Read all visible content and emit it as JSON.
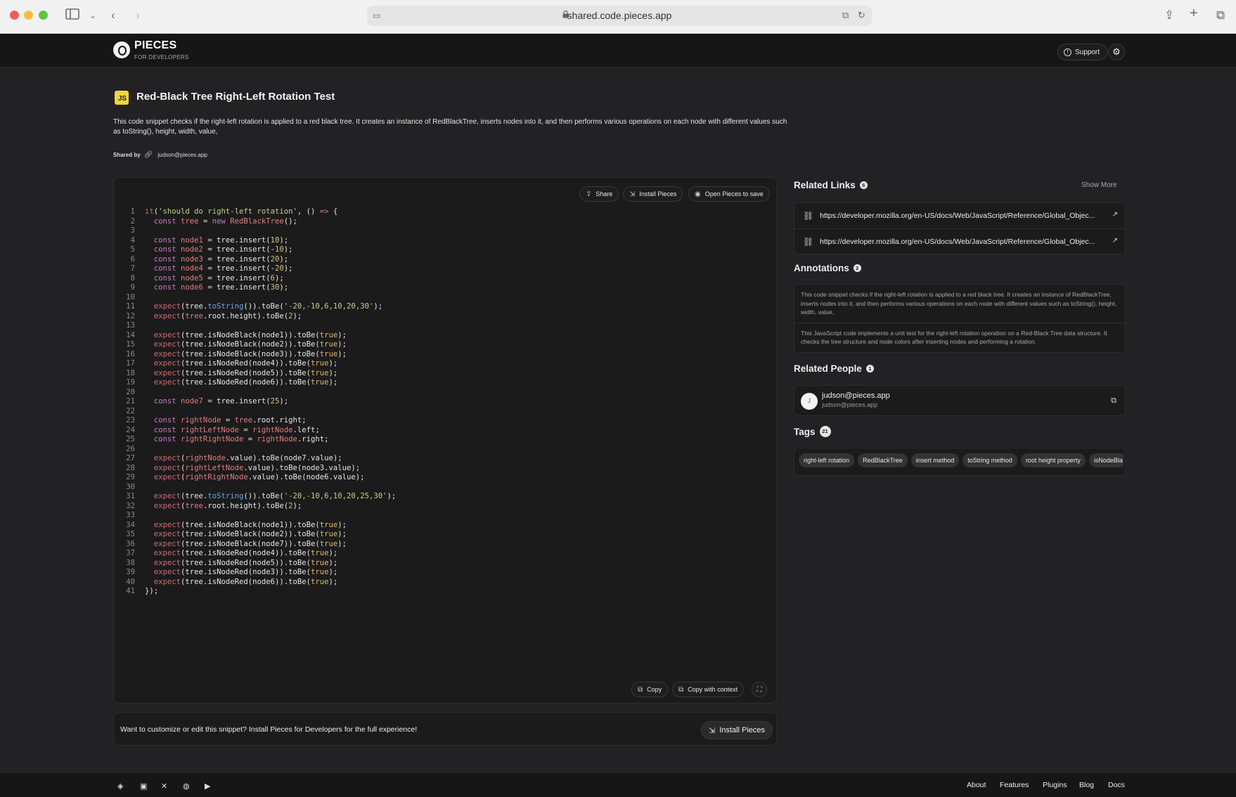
{
  "browser": {
    "url": "shared.code.pieces.app"
  },
  "header": {
    "brand": "PIECES",
    "brand_sub": "FOR DEVELOPERS",
    "support_label": "Support"
  },
  "snippet": {
    "language_badge": "JS",
    "title": "Red-Black Tree Right-Left Rotation Test",
    "description": "This code snippet checks if the right-left rotation is applied to a red black tree. It creates an instance of RedBlackTree, inserts nodes into it, and then performs various operations on each node with different values such as toString(), height, width, value,",
    "shared_by_label": "Shared by",
    "shared_by_email": "judson@pieces.app"
  },
  "code_toolbar": {
    "share": "Share",
    "install": "Install Pieces",
    "open": "Open Pieces to save"
  },
  "code_lines": [
    "<span class=\"k-fn\">it</span>(<span class=\"k-str\">'should do right-left rotation'</span>, () <span class=\"k-kw\">=&gt;</span> {",
    "  <span class=\"k-kw\">const</span> <span class=\"k-var\">tree</span> = <span class=\"k-kw\">new</span> <span class=\"k-var\">RedBlackTree</span>();",
    "",
    "  <span class=\"k-kw\">const</span> <span class=\"k-var\">node1</span> = tree.insert(<span class=\"k-num\">10</span>);",
    "  <span class=\"k-kw\">const</span> <span class=\"k-var\">node2</span> = tree.insert(-<span class=\"k-num\">10</span>);",
    "  <span class=\"k-kw\">const</span> <span class=\"k-var\">node3</span> = tree.insert(<span class=\"k-num\">20</span>);",
    "  <span class=\"k-kw\">const</span> <span class=\"k-var\">node4</span> = tree.insert(-<span class=\"k-num\">20</span>);",
    "  <span class=\"k-kw\">const</span> <span class=\"k-var\">node5</span> = tree.insert(<span class=\"k-num\">6</span>);",
    "  <span class=\"k-kw\">const</span> <span class=\"k-var\">node6</span> = tree.insert(<span class=\"k-num\">30</span>);",
    "",
    "  <span class=\"k-fn\">expect</span>(tree.<span class=\"k-meth\">toString</span>()).toBe(<span class=\"k-str\">'-20,-10,6,10,20,30'</span>);",
    "  <span class=\"k-fn\">expect</span>(<span class=\"k-var\">tree</span>.root.height).toBe(<span class=\"k-num\">2</span>);",
    "",
    "  <span class=\"k-fn\">expect</span>(tree.isNodeBlack(node1)).toBe(<span class=\"k-bool\">true</span>);",
    "  <span class=\"k-fn\">expect</span>(tree.isNodeBlack(node2)).toBe(<span class=\"k-bool\">true</span>);",
    "  <span class=\"k-fn\">expect</span>(tree.isNodeBlack(node3)).toBe(<span class=\"k-bool\">true</span>);",
    "  <span class=\"k-fn\">expect</span>(tree.isNodeRed(node4)).toBe(<span class=\"k-bool\">true</span>);",
    "  <span class=\"k-fn\">expect</span>(tree.isNodeRed(node5)).toBe(<span class=\"k-bool\">true</span>);",
    "  <span class=\"k-fn\">expect</span>(tree.isNodeRed(node6)).toBe(<span class=\"k-bool\">true</span>);",
    "",
    "  <span class=\"k-kw\">const</span> <span class=\"k-var\">node7</span> = tree.insert(<span class=\"k-num\">25</span>);",
    "",
    "  <span class=\"k-kw\">const</span> <span class=\"k-var\">rightNode</span> = <span class=\"k-var\">tree</span>.root.right;",
    "  <span class=\"k-kw\">const</span> <span class=\"k-var\">rightLeftNode</span> = <span class=\"k-var\">rightNode</span>.left;",
    "  <span class=\"k-kw\">const</span> <span class=\"k-var\">rightRightNode</span> = <span class=\"k-var\">rightNode</span>.right;",
    "",
    "  <span class=\"k-fn\">expect</span>(<span class=\"k-var\">rightNode</span>.value).toBe(node7.value);",
    "  <span class=\"k-fn\">expect</span>(<span class=\"k-var\">rightLeftNode</span>.value).toBe(node3.value);",
    "  <span class=\"k-fn\">expect</span>(<span class=\"k-var\">rightRightNode</span>.value).toBe(node6.value);",
    "",
    "  <span class=\"k-fn\">expect</span>(tree.<span class=\"k-meth\">toString</span>()).toBe(<span class=\"k-str\">'-20,-10,6,10,20,25,30'</span>);",
    "  <span class=\"k-fn\">expect</span>(<span class=\"k-var\">tree</span>.root.height).toBe(<span class=\"k-num\">2</span>);",
    "",
    "  <span class=\"k-fn\">expect</span>(tree.isNodeBlack(node1)).toBe(<span class=\"k-bool\">true</span>);",
    "  <span class=\"k-fn\">expect</span>(tree.isNodeBlack(node2)).toBe(<span class=\"k-bool\">true</span>);",
    "  <span class=\"k-fn\">expect</span>(tree.isNodeBlack(node7)).toBe(<span class=\"k-bool\">true</span>);",
    "  <span class=\"k-fn\">expect</span>(tree.isNodeRed(node4)).toBe(<span class=\"k-bool\">true</span>);",
    "  <span class=\"k-fn\">expect</span>(tree.isNodeRed(node5)).toBe(<span class=\"k-bool\">true</span>);",
    "  <span class=\"k-fn\">expect</span>(tree.isNodeRed(node3)).toBe(<span class=\"k-bool\">true</span>);",
    "  <span class=\"k-fn\">expect</span>(tree.isNodeRed(node6)).toBe(<span class=\"k-bool\">true</span>);",
    "});"
  ],
  "code_footer": {
    "copy": "Copy",
    "copy_context": "Copy with context"
  },
  "install_bar": {
    "text": "Want to customize or edit this snippet? Install Pieces for Developers for the full experience!",
    "button": "Install Pieces"
  },
  "related_links": {
    "title": "Related Links",
    "count": "6",
    "show_more": "Show More",
    "items": [
      "https://developer.mozilla.org/en-US/docs/Web/JavaScript/Reference/Global_Objec...",
      "https://developer.mozilla.org/en-US/docs/Web/JavaScript/Reference/Global_Objec..."
    ]
  },
  "annotations": {
    "title": "Annotations",
    "count": "2",
    "items": [
      "This code snippet checks if the right-left rotation is applied to a red black tree. It creates an instance of RedBlackTree, inserts nodes into it, and then performs various operations on each node with different values such as toString(), height, width, value,",
      "This JavaScript code implements a unit test for the right-left rotation operation on a Red-Black Tree data structure. It checks the tree structure and node colors after inserting nodes and performing a rotation."
    ]
  },
  "related_people": {
    "title": "Related People",
    "count": "1",
    "person": {
      "initial": "J",
      "name": "judson@pieces.app",
      "email": "judson@pieces.app"
    }
  },
  "tags": {
    "title": "Tags",
    "count": "21",
    "items": [
      "right-left rotation",
      "RedBlackTree",
      "insert method",
      "toString method",
      "root height property",
      "isNodeBla"
    ]
  },
  "footer": {
    "links": [
      "About",
      "Features",
      "Plugins",
      "Blog",
      "Docs"
    ]
  },
  "colors": {
    "background": "#222224",
    "header": "#161617",
    "panel": "#1b1b1c",
    "js_badge": "#f0d53a"
  }
}
